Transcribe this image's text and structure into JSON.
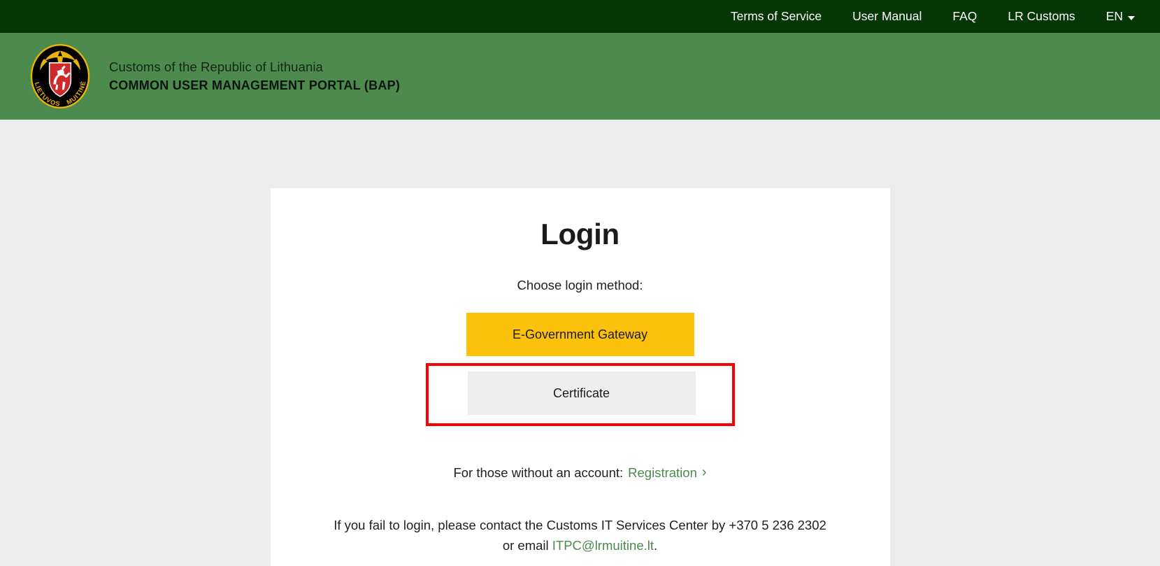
{
  "topbar": {
    "links": [
      {
        "label": "Terms of Service"
      },
      {
        "label": "User Manual"
      },
      {
        "label": "FAQ"
      },
      {
        "label": "LR Customs"
      }
    ],
    "language": {
      "label": "EN",
      "icon": "chevron-down-icon"
    },
    "background_color": "#053605"
  },
  "header": {
    "logo": {
      "icon": "lithuanian-customs-seal-logo",
      "ring_text": "LIETUVOS MUITINĖ",
      "ring_color": "#e8b40a",
      "field_color": "#000000",
      "shield_color": "#cf2a2a"
    },
    "organisation": "Customs of the Republic of Lithuania",
    "portal_name": "COMMON USER MANAGEMENT PORTAL (BAP)",
    "background_color": "#4c8b4d"
  },
  "login_card": {
    "title": "Login",
    "choose_label": "Choose login method:",
    "methods": [
      {
        "label": "E-Government Gateway",
        "style": "primary",
        "color": "#fcc10a",
        "highlighted": false
      },
      {
        "label": "Certificate",
        "style": "secondary",
        "color": "#eeeeee",
        "highlighted": true
      }
    ],
    "highlight_color": "#fb0000",
    "registration": {
      "prefix": "For those without an account:",
      "link_label": "Registration",
      "chevron": "›",
      "link_color": "#4b8a4c"
    },
    "support": {
      "line1": "If you fail to login, please contact the Customs IT Services Center by +370 5 236 2302",
      "line2_prefix": "or email ",
      "email": "ITPC@lrmuitine.lt",
      "line2_suffix": ".",
      "phone": "+370 5 236 2302"
    }
  },
  "page": {
    "background_color": "#ececec",
    "card_background": "#ffffff"
  }
}
